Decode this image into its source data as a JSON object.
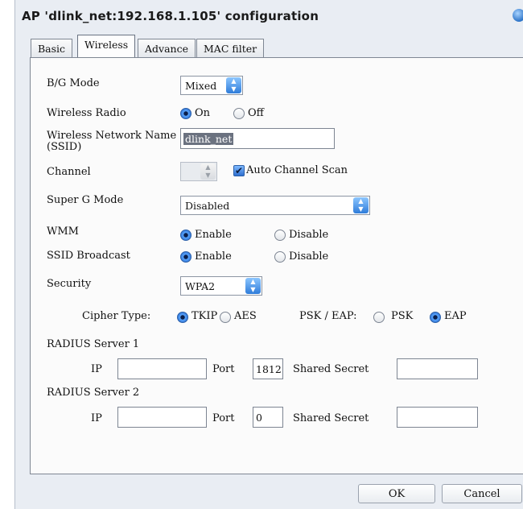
{
  "window": {
    "title": "AP 'dlink_net:192.168.1.105' configuration"
  },
  "tabs": [
    {
      "label": "Basic",
      "active": false
    },
    {
      "label": "Wireless",
      "active": true
    },
    {
      "label": "Advance",
      "active": false
    },
    {
      "label": "MAC filter",
      "active": false
    }
  ],
  "form": {
    "bg_mode": {
      "label": "B/G Mode",
      "value": "Mixed"
    },
    "wireless_radio": {
      "label": "Wireless Radio",
      "options": [
        "On",
        "Off"
      ],
      "selected": "On"
    },
    "ssid": {
      "label_line1": "Wireless Network Name",
      "label_line2": "(SSID)",
      "value": "dlink_net"
    },
    "channel": {
      "label": "Channel",
      "value": "",
      "auto_scan_label": "Auto Channel Scan",
      "auto_scan_checked": true
    },
    "super_g": {
      "label": "Super G Mode",
      "value": "Disabled"
    },
    "wmm": {
      "label": "WMM",
      "options": [
        "Enable",
        "Disable"
      ],
      "selected": "Enable"
    },
    "ssid_broadcast": {
      "label": "SSID Broadcast",
      "options": [
        "Enable",
        "Disable"
      ],
      "selected": "Enable"
    },
    "security": {
      "label": "Security",
      "value": "WPA2"
    },
    "cipher": {
      "label": "Cipher Type:",
      "options": [
        "TKIP",
        "AES"
      ],
      "selected": "TKIP"
    },
    "psk_eap": {
      "label": "PSK / EAP:",
      "options": [
        "PSK",
        "EAP"
      ],
      "selected": "EAP"
    },
    "radius1": {
      "label": "RADIUS Server 1",
      "ip_label": "IP",
      "ip": "",
      "port_label": "Port",
      "port": "1812",
      "secret_label": "Shared Secret",
      "secret": ""
    },
    "radius2": {
      "label": "RADIUS Server 2",
      "ip_label": "IP",
      "ip": "",
      "port_label": "Port",
      "port": "0",
      "secret_label": "Shared Secret",
      "secret": ""
    }
  },
  "buttons": {
    "ok": "OK",
    "cancel": "Cancel"
  },
  "icons": {
    "title_orb": "globe-icon",
    "stepper": "up-down-arrows-icon",
    "check": "checkmark-icon"
  },
  "colors": {
    "accent": "#2f6fd0",
    "window_bg": "#e9edf3",
    "panel_bg": "#fbfbfb"
  }
}
